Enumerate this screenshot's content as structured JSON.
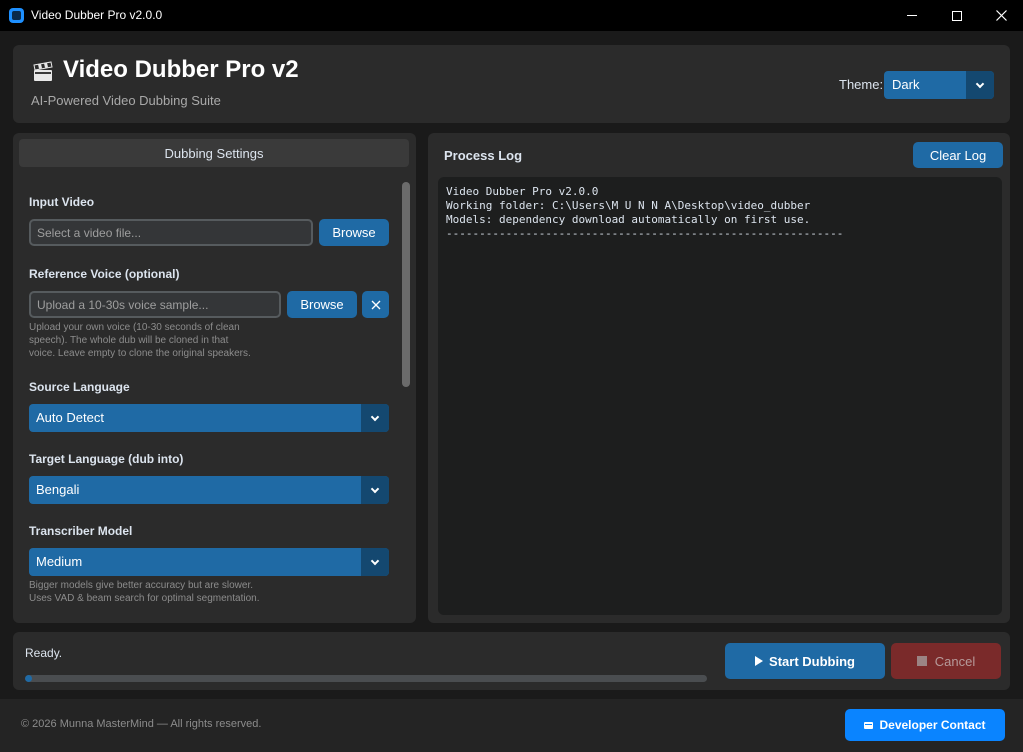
{
  "window": {
    "title": "Video Dubber Pro v2.0.0",
    "minimize_icon": "minimize-icon",
    "maximize_icon": "maximize-icon",
    "close_icon": "close-icon"
  },
  "header": {
    "icon": "clapperboard-icon",
    "title": "Video Dubber Pro v2",
    "subtitle": "AI-Powered Video Dubbing Suite",
    "theme_label": "Theme:",
    "theme_value": "Dark"
  },
  "settings": {
    "header": "Dubbing Settings",
    "input_video": {
      "label": "Input Video",
      "placeholder": "Select a video file...",
      "browse_label": "Browse"
    },
    "reference_voice": {
      "label": "Reference Voice (optional)",
      "placeholder": "Upload a 10-30s voice sample...",
      "browse_label": "Browse",
      "clear_icon": "x-icon",
      "hint_lines": [
        "Upload your own voice (10-30 seconds of clean",
        "speech). The whole dub will be cloned in that",
        "voice. Leave empty to clone the original speakers."
      ]
    },
    "source_language": {
      "label": "Source Language",
      "value": "Auto Detect"
    },
    "target_language": {
      "label": "Target Language (dub into)",
      "value": "Bengali"
    },
    "transcriber": {
      "label": "Transcriber Model",
      "value": "Medium",
      "hint_lines": [
        "Bigger models give better accuracy but are slower.",
        "Uses VAD & beam search for optimal segmentation."
      ]
    }
  },
  "log": {
    "title": "Process Log",
    "clear_label": "Clear Log",
    "lines": [
      "Video Dubber Pro v2.0.0",
      "Working folder: C:\\Users\\M U N N A\\Desktop\\video_dubber",
      "Models: dependency download automatically on first use.",
      "------------------------------------------------------------"
    ]
  },
  "status": {
    "text": "Ready.",
    "progress_fraction": 0.01,
    "start_label": "Start Dubbing",
    "start_icon": "play-icon",
    "cancel_label": "Cancel",
    "cancel_icon": "stop-icon"
  },
  "footer": {
    "copyright": "© 2026 Munna MasterMind — All rights reserved.",
    "dev_label": "Developer Contact",
    "dev_icon": "contact-card-icon"
  },
  "colors": {
    "accent": "#1f6aa5",
    "accent_dark": "#144870",
    "cancel": "#7a2a2a",
    "dev_button": "#0a84ff",
    "panel": "#2b2b2b",
    "background": "#1a1a1a"
  }
}
